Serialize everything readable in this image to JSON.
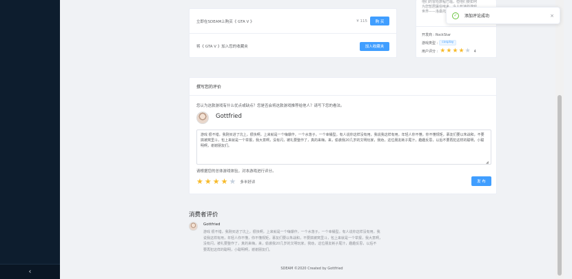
{
  "sidebar": {
    "collapse_icon": "chevron-left-icon",
    "collapse_glyph": "‹"
  },
  "buy": {
    "purchase_text": "立即在SDEAM上购买《 GTA V 》",
    "price": "¥ 115",
    "buy_label": "购 买",
    "wishlist_text": "将《 GTA V 》加入您的收藏夹",
    "wishlist_label": "加入收藏夹"
  },
  "info": {
    "desc_lines": [
      "他们的冒险旅程已临，但他们要如何",
      "为您暂居廛俗味来。令人叹迷的游戏",
      "世界——洛桑托斯市和布雷恩郡。"
    ],
    "developer": "开发商 : RockStar",
    "genre_label": "游戏类型 :",
    "genre_tag": "cosplay",
    "rating_label": "用户评分 :",
    "rating_value": "4",
    "rating_stars": 4
  },
  "review": {
    "header": "撰写您的评价",
    "prompt": "您认为这款游戏有什么优点或缺点？您是否会将这款游戏推荐给他人？请写下您的看法。",
    "user_name": "Gottfried",
    "text": "游戏 很不错，我刚买进了坑上，很快啊，上来就是一个嗨爆作，一个水落子，一个幸桶型。有人说你这样没有用，我说我这样有用，年轻人你不懂，你不懂规矩，慕友们要以朱战和，不要搞被窝里斗，包上来就是一个举报，我大意啊，没有闪，被礼要整作了，真的来嗨，来，偷袭我20几岁的文明玩家，我劝，这位朋友耗子尾汁，趣趣反思，以后不要再犯这样的聪明，小聪明啊，谢谢朋友们。",
    "rate_hint": "请根据您的总体游戏体验，对本游戏进行评分。",
    "rating_stars": 4,
    "rating_label": "多半好评",
    "publish_label": "发 布"
  },
  "consumer": {
    "title": "消费者评价",
    "items": [
      {
        "name": "Gottfried",
        "lines": [
          "游戏 很不错，我刚买进了坑上，很快啊，上来就是一个嗨爆作，一个水落子，一个幸桶型。有人说你这样没有用，我",
          "说我这样有用，年轻人你不懂，你不懂规矩，慕友们要以朱战和，不要搞被窝里斗，包上来就是一个举报，我大意啊，",
          "没有闪，被礼要整作了，真的来嗨，来，偷袭我20几岁的文明玩家，我劝，这位朋友耗子尾汁，趣趣反思，以后不",
          "要再犯这样的聪明，小聪明啊，谢谢朋友们。"
        ]
      }
    ]
  },
  "footer": {
    "text": "SDEAM ©2020 Created by Gottfried"
  },
  "toast": {
    "text": "添加评论成功",
    "icon": "check-circle-icon",
    "check_glyph": "✓",
    "close_glyph": "×"
  },
  "colors": {
    "primary": "#409eff",
    "sidebar": "#0d1d2e",
    "star": "#f7ba2a",
    "success": "#67c23a"
  }
}
